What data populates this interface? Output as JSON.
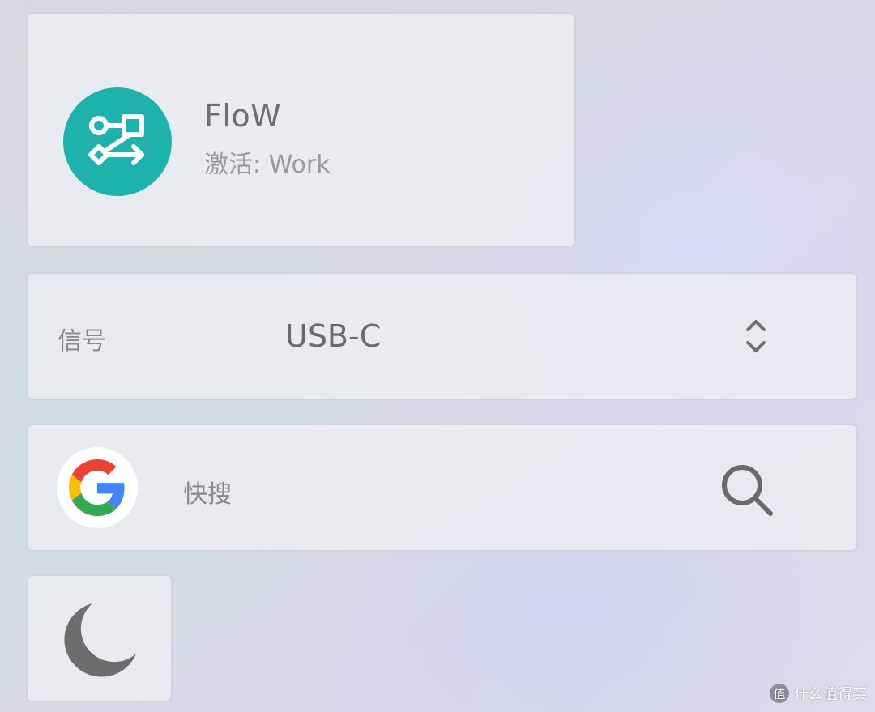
{
  "flow": {
    "title": "FloW",
    "status": "激活: Work",
    "icon": "flow-route-icon",
    "accent": "#1db2ab"
  },
  "signal": {
    "label": "信号",
    "value": "USB-C",
    "icon": "chevron-up-down-icon"
  },
  "search": {
    "label": "快搜",
    "logo": "google-g-icon",
    "icon": "search-icon"
  },
  "night": {
    "icon": "moon-icon"
  },
  "watermark": {
    "badge": "值",
    "text": "什么值得买"
  }
}
